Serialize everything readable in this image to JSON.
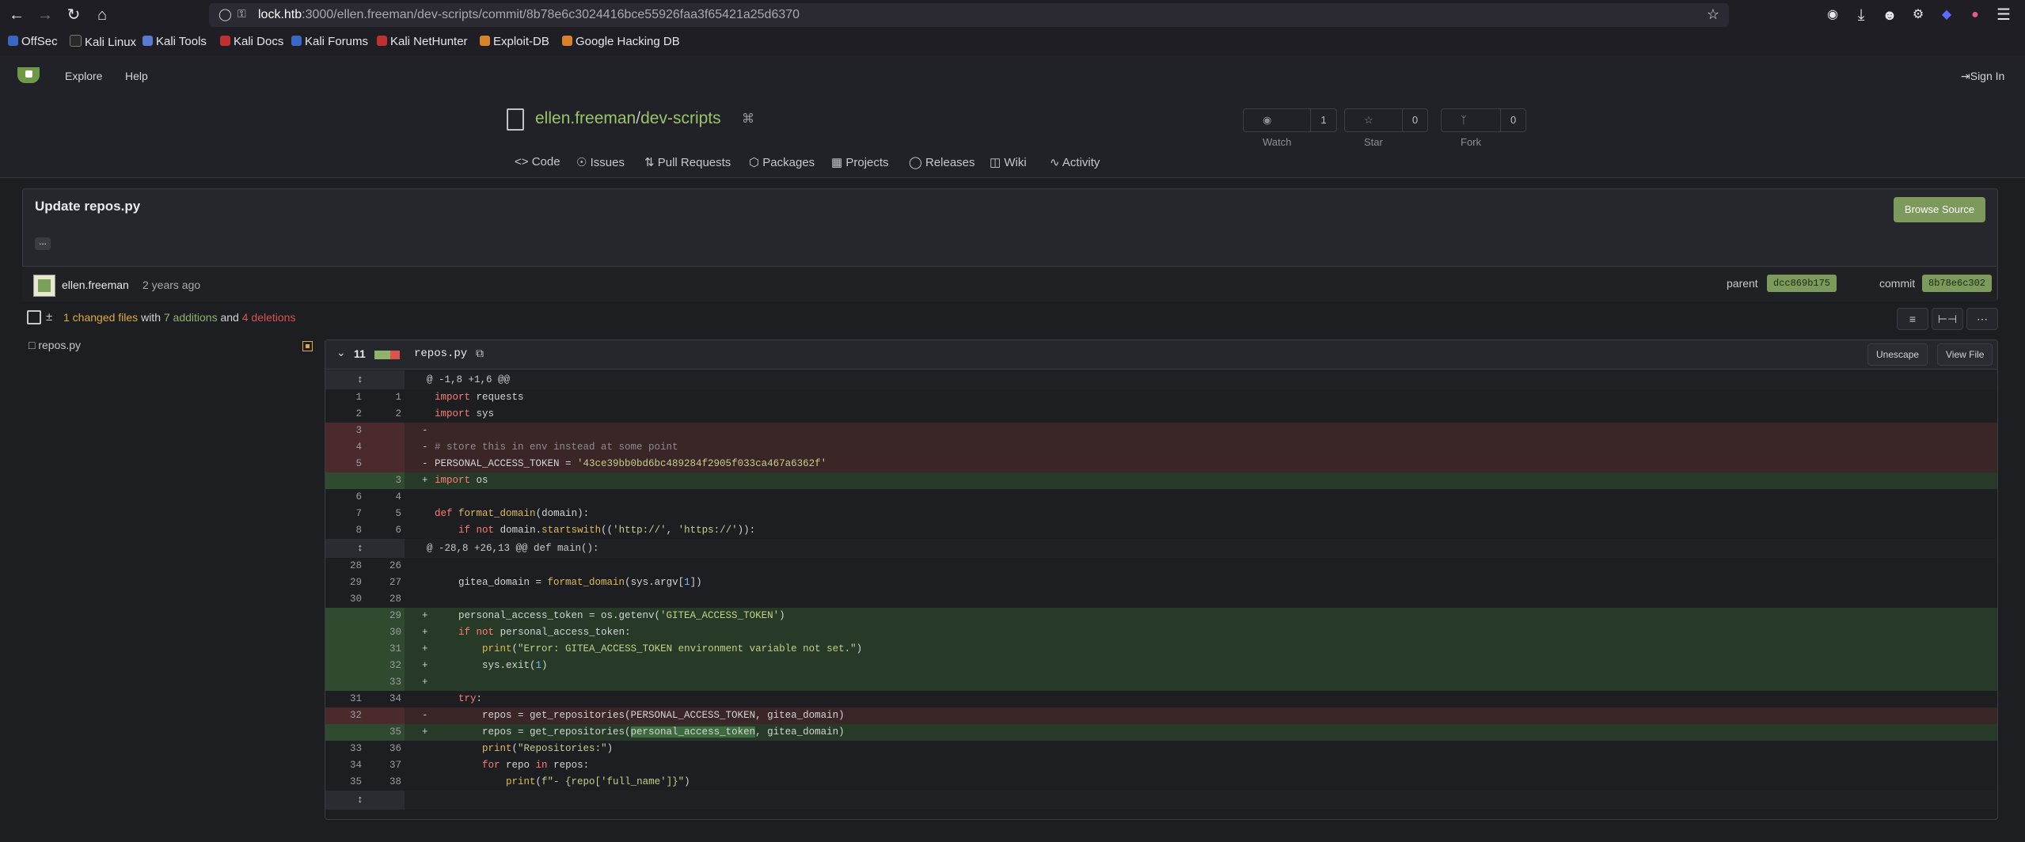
{
  "browser": {
    "url_host": "lock.htb",
    "url_path": ":3000/ellen.freeman/dev-scripts/commit/8b78e6c3024416bce55926faa3f65421a25d6370",
    "bookmarks": [
      "OffSec",
      "Kali Linux",
      "Kali Tools",
      "Kali Docs",
      "Kali Forums",
      "Kali NetHunter",
      "Exploit-DB",
      "Google Hacking DB"
    ]
  },
  "nav": {
    "explore": "Explore",
    "help": "Help",
    "signin": "Sign In"
  },
  "repo": {
    "owner": "ellen.freeman",
    "sep": "/",
    "name": "dev-scripts",
    "watch_label": "Watch",
    "watch_count": "1",
    "star_label": "Star",
    "star_count": "0",
    "fork_label": "Fork",
    "fork_count": "0",
    "tabs": [
      "Code",
      "Issues",
      "Pull Requests",
      "Packages",
      "Projects",
      "Releases",
      "Wiki",
      "Activity"
    ]
  },
  "commit": {
    "title": "Update repos.py",
    "browse_label": "Browse Source",
    "ellipsis": "...",
    "author": "ellen.freeman",
    "time": "2 years ago",
    "parent_label": "parent",
    "parent_sha": "dcc869b175",
    "commit_label": "commit",
    "commit_sha": "8b78e6c302"
  },
  "summary": {
    "changed": "1 changed files",
    "with": "with",
    "additions": "7 additions",
    "and": "and",
    "deletions": "4 deletions"
  },
  "file": {
    "name": "repos.py",
    "count": "11",
    "unescape_label": "Unescape",
    "view_label": "View File"
  },
  "colors": {
    "addition": "#8fb36a",
    "deletion": "#d9534f",
    "accent": "#7c9a5c"
  },
  "diff": [
    {
      "t": "hunk",
      "o": "",
      "n": "",
      "s": "",
      "c": "@ -1,8 +1,6 @@"
    },
    {
      "t": "ctx",
      "o": "1",
      "n": "1",
      "s": "",
      "c": "import requests"
    },
    {
      "t": "ctx",
      "o": "2",
      "n": "2",
      "s": "",
      "c": "import sys"
    },
    {
      "t": "del",
      "o": "3",
      "n": "",
      "s": "-",
      "c": ""
    },
    {
      "t": "del",
      "o": "4",
      "n": "",
      "s": "-",
      "c": "# store this in env instead at some point"
    },
    {
      "t": "del",
      "o": "5",
      "n": "",
      "s": "-",
      "c": "PERSONAL_ACCESS_TOKEN = '43ce39bb0bd6bc489284f2905f033ca467a6362f'"
    },
    {
      "t": "add",
      "o": "",
      "n": "3",
      "s": "+",
      "c": "import os"
    },
    {
      "t": "ctx",
      "o": "6",
      "n": "4",
      "s": "",
      "c": ""
    },
    {
      "t": "ctx",
      "o": "7",
      "n": "5",
      "s": "",
      "c": "def format_domain(domain):"
    },
    {
      "t": "ctx",
      "o": "8",
      "n": "6",
      "s": "",
      "c": "    if not domain.startswith(('http://', 'https://')):"
    },
    {
      "t": "hunk",
      "o": "",
      "n": "",
      "s": "",
      "c": "@ -28,8 +26,13 @@ def main():"
    },
    {
      "t": "ctx",
      "o": "28",
      "n": "26",
      "s": "",
      "c": ""
    },
    {
      "t": "ctx",
      "o": "29",
      "n": "27",
      "s": "",
      "c": "    gitea_domain = format_domain(sys.argv[1])"
    },
    {
      "t": "ctx",
      "o": "30",
      "n": "28",
      "s": "",
      "c": ""
    },
    {
      "t": "add",
      "o": "",
      "n": "29",
      "s": "+",
      "c": "    personal_access_token = os.getenv('GITEA_ACCESS_TOKEN')"
    },
    {
      "t": "add",
      "o": "",
      "n": "30",
      "s": "+",
      "c": "    if not personal_access_token:"
    },
    {
      "t": "add",
      "o": "",
      "n": "31",
      "s": "+",
      "c": "        print(\"Error: GITEA_ACCESS_TOKEN environment variable not set.\")"
    },
    {
      "t": "add",
      "o": "",
      "n": "32",
      "s": "+",
      "c": "        sys.exit(1)"
    },
    {
      "t": "add",
      "o": "",
      "n": "33",
      "s": "+",
      "c": ""
    },
    {
      "t": "ctx",
      "o": "31",
      "n": "34",
      "s": "",
      "c": "    try:"
    },
    {
      "t": "del",
      "o": "32",
      "n": "",
      "s": "-",
      "c": "        repos = get_repositories(PERSONAL_ACCESS_TOKEN, gitea_domain)"
    },
    {
      "t": "add",
      "o": "",
      "n": "35",
      "s": "+",
      "c": "        repos = get_repositories(personal_access_token, gitea_domain)"
    },
    {
      "t": "ctx",
      "o": "33",
      "n": "36",
      "s": "",
      "c": "        print(\"Repositories:\")"
    },
    {
      "t": "ctx",
      "o": "34",
      "n": "37",
      "s": "",
      "c": "        for repo in repos:"
    },
    {
      "t": "ctx",
      "o": "35",
      "n": "38",
      "s": "",
      "c": "            print(f\"- {repo['full_name']}\")"
    },
    {
      "t": "hunk",
      "o": "",
      "n": "",
      "s": "",
      "c": ""
    }
  ]
}
